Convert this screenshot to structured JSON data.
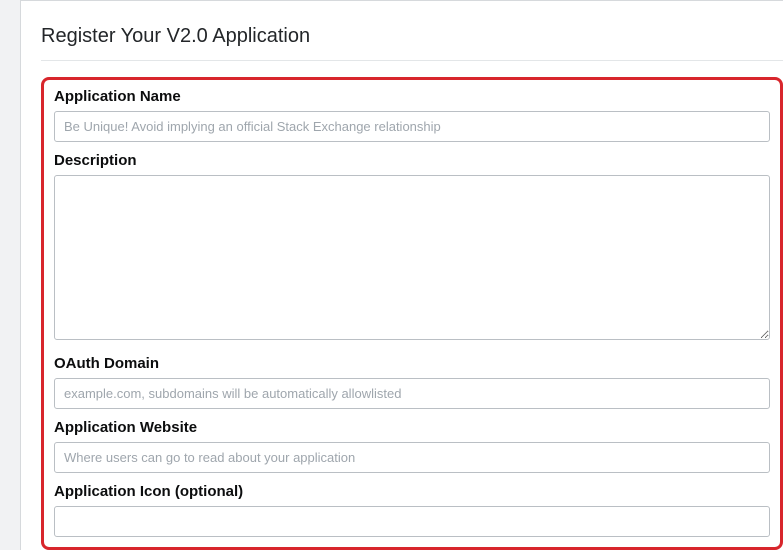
{
  "page": {
    "title": "Register Your V2.0 Application"
  },
  "form": {
    "fields": {
      "app_name": {
        "label": "Application Name",
        "placeholder": "Be Unique! Avoid implying an official Stack Exchange relationship",
        "value": ""
      },
      "description": {
        "label": "Description",
        "placeholder": "",
        "value": ""
      },
      "oauth_domain": {
        "label": "OAuth Domain",
        "placeholder": "example.com, subdomains will be automatically allowlisted",
        "value": ""
      },
      "website": {
        "label": "Application Website",
        "placeholder": "Where users can go to read about your application",
        "value": ""
      },
      "icon": {
        "label": "Application Icon (optional)",
        "placeholder": "",
        "value": ""
      }
    }
  }
}
